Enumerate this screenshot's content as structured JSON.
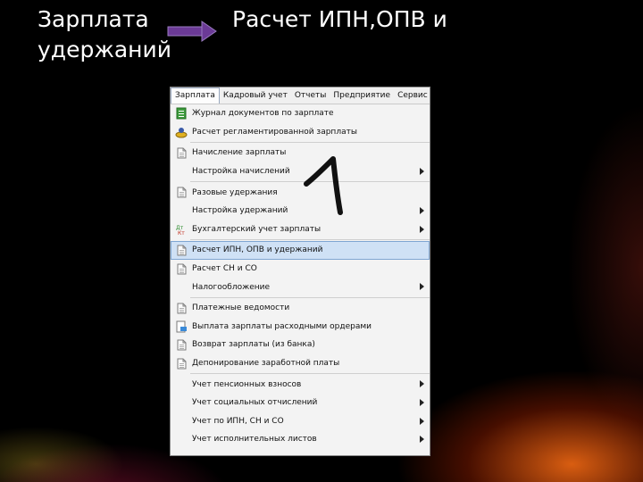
{
  "title": {
    "line1": "Зарплата",
    "line2": "удержаний",
    "right": "Расчет ИПН,ОПВ и"
  },
  "menubar": [
    "Зарплата",
    "Кадровый учет",
    "Отчеты",
    "Предприятие",
    "Сервис"
  ],
  "menu": {
    "items": [
      {
        "label": "Журнал документов по зарплате",
        "icon": "journal-icon",
        "submenu": false
      },
      {
        "label": "Расчет регламентированной зарплаты",
        "icon": "payroll-calc-icon",
        "submenu": false
      },
      {
        "separator": true
      },
      {
        "label": "Начисление зарплаты",
        "icon": "document-icon",
        "submenu": false
      },
      {
        "label": "Настройка начислений",
        "icon": "",
        "submenu": true
      },
      {
        "separator": true
      },
      {
        "label": "Разовые удержания",
        "icon": "document-icon",
        "submenu": false
      },
      {
        "label": "Настройка удержаний",
        "icon": "",
        "submenu": true
      },
      {
        "label": "Бухгалтерский учет зарплаты",
        "icon": "accounting-icon",
        "submenu": true
      },
      {
        "separator": true
      },
      {
        "label": "Расчет ИПН, ОПВ и удержаний",
        "icon": "document-icon",
        "submenu": false,
        "highlighted": true
      },
      {
        "label": "Расчет СН и СО",
        "icon": "document-icon",
        "submenu": false
      },
      {
        "label": "Налогообложение",
        "icon": "",
        "submenu": true
      },
      {
        "separator": true
      },
      {
        "label": "Платежные ведомости",
        "icon": "document-icon",
        "submenu": false
      },
      {
        "label": "Выплата зарплаты расходными ордерами",
        "icon": "cash-order-icon",
        "submenu": false
      },
      {
        "label": "Возврат зарплаты (из банка)",
        "icon": "document-icon",
        "submenu": false
      },
      {
        "label": "Депонирование заработной платы",
        "icon": "document-icon",
        "submenu": false
      },
      {
        "separator": true
      },
      {
        "label": "Учет пенсионных взносов",
        "icon": "",
        "submenu": true
      },
      {
        "label": "Учет социальных отчислений",
        "icon": "",
        "submenu": true
      },
      {
        "label": "Учет по ИПН, СН и СО",
        "icon": "",
        "submenu": true
      },
      {
        "label": "Учет исполнительных листов",
        "icon": "",
        "submenu": true
      }
    ]
  },
  "colors": {
    "highlight": "#cfe1f5",
    "arrow": "#7b3fa0",
    "text": "#ffffff"
  }
}
